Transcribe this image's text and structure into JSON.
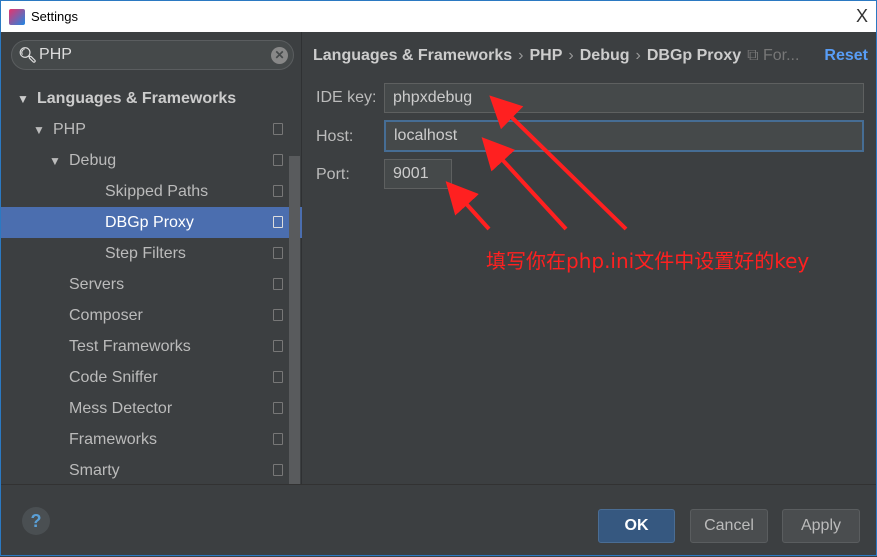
{
  "window": {
    "title": "Settings",
    "close": "X"
  },
  "search": {
    "value": "PHP"
  },
  "tree": [
    {
      "label": "Languages & Frameworks",
      "level": 0,
      "expanded": true
    },
    {
      "label": "PHP",
      "level": 1,
      "expanded": true
    },
    {
      "label": "Debug",
      "level": 2,
      "expanded": true
    },
    {
      "label": "Skipped Paths",
      "level": 3
    },
    {
      "label": "DBGp Proxy",
      "level": 3,
      "selected": true
    },
    {
      "label": "Step Filters",
      "level": 3
    },
    {
      "label": "Servers",
      "level": 2
    },
    {
      "label": "Composer",
      "level": 2
    },
    {
      "label": "Test Frameworks",
      "level": 2
    },
    {
      "label": "Code Sniffer",
      "level": 2
    },
    {
      "label": "Mess Detector",
      "level": 2
    },
    {
      "label": "Frameworks",
      "level": 2
    },
    {
      "label": "Smarty",
      "level": 2
    }
  ],
  "breadcrumb": {
    "items": [
      "Languages & Frameworks",
      "PHP",
      "Debug",
      "DBGp Proxy"
    ],
    "suffix": "For...",
    "reset": "Reset"
  },
  "form": {
    "ide_key_label": "IDE key:",
    "ide_key": "phpxdebug",
    "host_label": "Host:",
    "host": "localhost",
    "port_label": "Port:",
    "port": "9001"
  },
  "annotation": {
    "text": "填写你在php.ini文件中设置好的key",
    "color": "#ff2020"
  },
  "footer": {
    "help": "?",
    "ok": "OK",
    "cancel": "Cancel",
    "apply": "Apply"
  },
  "colors": {
    "selection": "#4b6eaf",
    "accent": "#589df6"
  }
}
